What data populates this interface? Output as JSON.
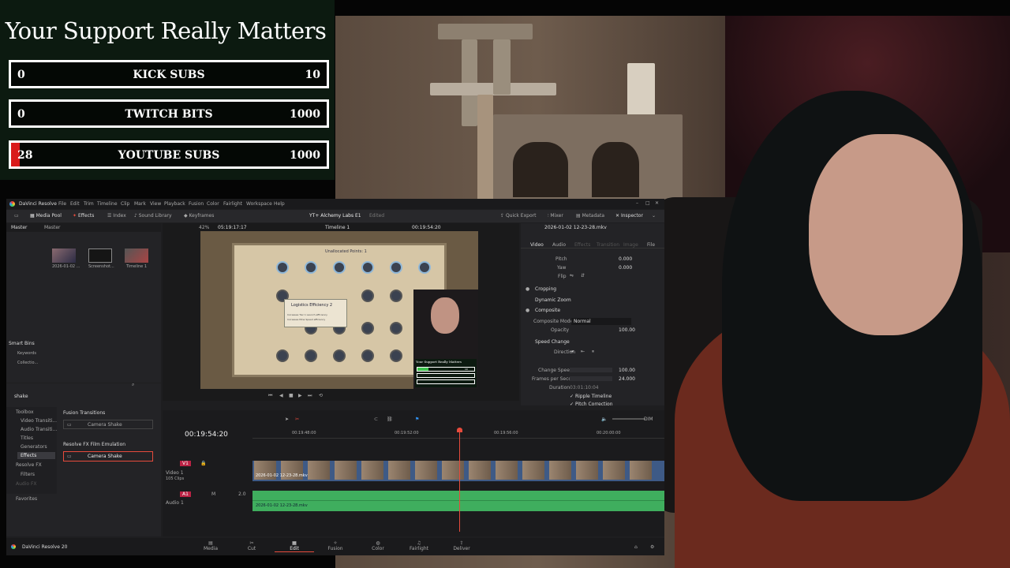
{
  "overlay": {
    "title": "Your Support Really Matters",
    "goals": [
      {
        "current": "0",
        "label": "KICK SUBS",
        "max": "10",
        "progress": 0
      },
      {
        "current": "0",
        "label": "TWITCH BITS",
        "max": "1000",
        "progress": 0
      },
      {
        "current": "28",
        "label": "YOUTUBE SUBS",
        "max": "1000",
        "progress": 0.028
      }
    ]
  },
  "colors": {
    "goal_fill": "#d91a1a",
    "audio_track": "#3fae5e",
    "playhead": "#e64b3c",
    "accent": "#e64b3c"
  },
  "resolve": {
    "app_name": "DaVinci Resolve",
    "menu": [
      "File",
      "Edit",
      "Trim",
      "Timeline",
      "Clip",
      "Mark",
      "View",
      "Playback",
      "Fusion",
      "Color",
      "Fairlight",
      "Workspace",
      "Help"
    ],
    "toolbar_left": [
      "Media Pool",
      "Effects",
      "Index",
      "Sound Library",
      "Keyframes"
    ],
    "project_title": "YT+ Alchemy Labs E1",
    "project_status": "Edited",
    "toolbar_right": [
      "Quick Export",
      "Mixer",
      "Metadata",
      "Inspector"
    ],
    "media_pool": {
      "bin_master": "Master",
      "breadcrumb": "Master",
      "clips": [
        {
          "name": "2026-01-02 ..."
        },
        {
          "name": "Screenshot..."
        },
        {
          "name": "Timeline 1"
        }
      ],
      "smart_bins_label": "Smart Bins",
      "smart_bins": [
        "Keywords",
        "Collectio..."
      ]
    },
    "viewer": {
      "zoom": "42%",
      "source_tc": "05:19:17:17",
      "timeline_name": "Timeline 1",
      "timecode": "00:19:54:20",
      "game_banner": "Unallocated Points: 1",
      "game_popup_title": "Logistics Efficiency 2",
      "game_popup_text_1": "Increases Tier 1 Launch efficiency",
      "game_popup_text_2": "Increases Mine Speed efficiency",
      "pip_title": "Your Support Really Matters",
      "pip_max": "10"
    },
    "inspector": {
      "clip_title": "2026-01-02 12-23-28.mkv",
      "tabs": [
        "Video",
        "Audio",
        "Effects",
        "Transition",
        "Image",
        "File"
      ],
      "rows": [
        {
          "label": "Pitch",
          "value": "0.000"
        },
        {
          "label": "Yaw",
          "value": "0.000"
        },
        {
          "label": "Flip",
          "value": ""
        }
      ],
      "sections": [
        "Cropping",
        "Dynamic Zoom",
        "Composite",
        "Speed Change"
      ],
      "composite_mode_label": "Composite Mode",
      "composite_mode_value": "Normal",
      "opacity_label": "Opacity",
      "opacity_value": "100.00",
      "direction_label": "Direction",
      "change_speed_label": "Change Speed",
      "change_speed_value": "100.00",
      "fps_label": "Frames per Second",
      "fps_value": "24.000",
      "duration_label": "Duration",
      "duration_value": "03:01:10:04",
      "ripple_label": "Ripple Timeline",
      "pitch_correction_label": "Pitch Correction"
    },
    "effects": {
      "search_value": "shake",
      "tree": [
        {
          "label": "Toolbox",
          "selected": false
        },
        {
          "label": "Video Transiti...",
          "selected": false
        },
        {
          "label": "Audio Transiti...",
          "selected": false
        },
        {
          "label": "Titles",
          "selected": false
        },
        {
          "label": "Generators",
          "selected": false
        },
        {
          "label": "Effects",
          "selected": true
        },
        {
          "label": "Resolve FX",
          "selected": false
        },
        {
          "label": "Filters",
          "selected": false
        },
        {
          "label": "Audio FX",
          "selected": false
        }
      ],
      "favorites_label": "Favorites",
      "group1": "Fusion Transitions",
      "group1_item": "Camera Shake",
      "group2": "Resolve FX Film Emulation",
      "group2_item": "Camera Shake"
    },
    "timeline": {
      "timecode": "00:19:54:20",
      "ruler": [
        "00:19:48:00",
        "00:19:52:00",
        "00:19:56:00",
        "00:20:00:00"
      ],
      "meter_label": "DIM",
      "v1_tag": "V1",
      "v1_name": "Video 1",
      "v1_count": "105 Clips",
      "a1_tag": "A1",
      "a1_name": "Audio 1",
      "a1_level": "2.0",
      "clip_label_v": "2026-01-02 12-23-28.mkv",
      "clip_label_a": "2026-01-02 12-23-28.mkv"
    },
    "footer": {
      "brand": "DaVinci Resolve 20",
      "pages": [
        "Media",
        "Cut",
        "Edit",
        "Fusion",
        "Color",
        "Fairlight",
        "Deliver"
      ],
      "active_page": "Edit"
    }
  }
}
